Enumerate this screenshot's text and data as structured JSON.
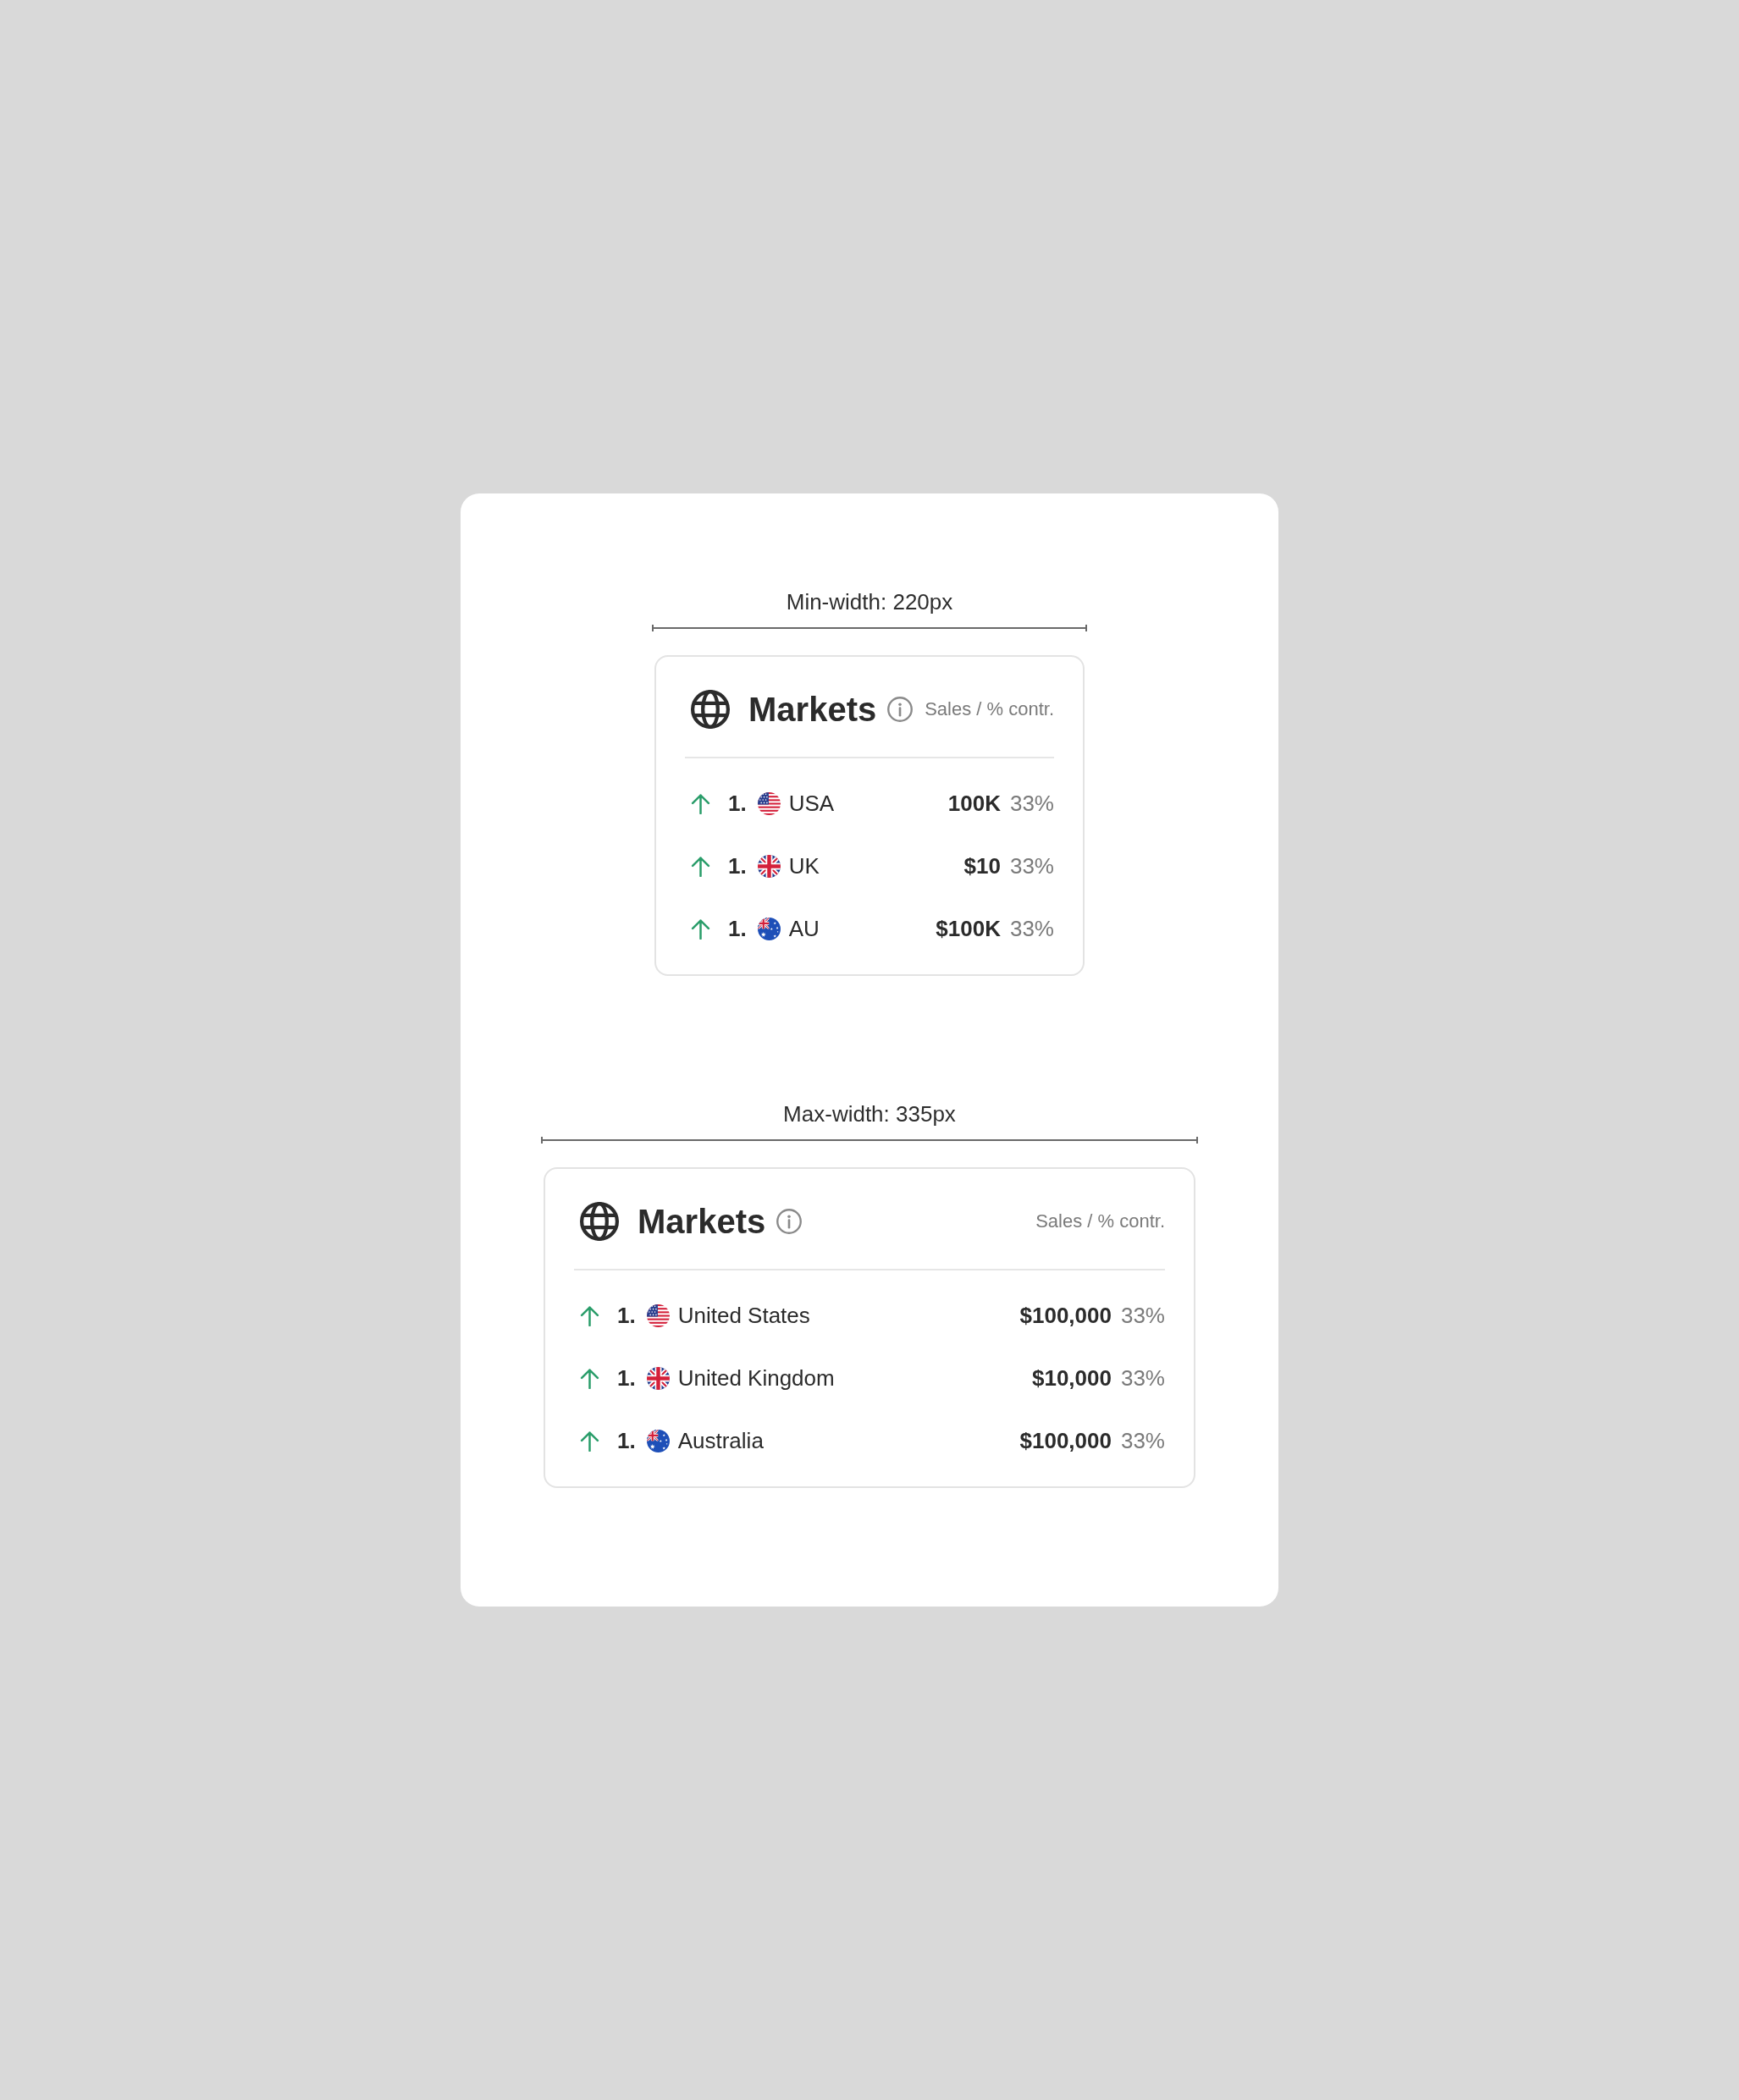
{
  "variants": [
    {
      "kind": "narrow",
      "label": "Min-width: 220px",
      "card": {
        "title": "Markets",
        "subtitle": "Sales / % contr.",
        "rows": [
          {
            "kind": "us",
            "rising": true,
            "rank": "1.",
            "country": "USA",
            "value": "100K",
            "share": "33%"
          },
          {
            "kind": "gb",
            "rising": true,
            "rank": "1.",
            "country": "UK",
            "value": "$10",
            "share": "33%"
          },
          {
            "kind": "au",
            "rising": true,
            "rank": "1.",
            "country": "AU",
            "value": "$100K",
            "share": "33%"
          }
        ]
      }
    },
    {
      "kind": "wide",
      "label": "Max-width: 335px",
      "card": {
        "title": "Markets",
        "subtitle": "Sales / % contr.",
        "rows": [
          {
            "kind": "us",
            "rising": true,
            "rank": "1.",
            "country": "United States",
            "value": "$100,000",
            "share": "33%"
          },
          {
            "kind": "gb",
            "rising": true,
            "rank": "1.",
            "country": "United Kingdom",
            "value": "$10,000",
            "share": "33%"
          },
          {
            "kind": "au",
            "rising": true,
            "rank": "1.",
            "country": "Australia",
            "value": "$100,000",
            "share": "33%"
          }
        ]
      }
    }
  ]
}
